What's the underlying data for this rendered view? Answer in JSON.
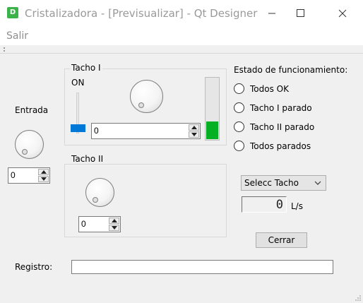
{
  "window": {
    "app_icon_letter": "D",
    "title": "Cristalizadora - [Previsualizar] - Qt Designer"
  },
  "menu": {
    "items": [
      "Salir"
    ]
  },
  "entrada": {
    "label": "Entrada",
    "spin_value": "0"
  },
  "tacho1": {
    "group_title": "Tacho I",
    "on_label": "ON",
    "spin_value": "0",
    "level_percent": 28,
    "level_color": "#06b025",
    "slider_color": "#0078d7"
  },
  "tacho2": {
    "group_title": "Tacho II",
    "spin_value": "0"
  },
  "estado": {
    "title": "Estado de funcionamiento:",
    "options": [
      "Todos OK",
      "Tacho I parado",
      "Tacho II parado",
      "Todos parados"
    ]
  },
  "combo": {
    "value": "Selecc Tacho"
  },
  "flow": {
    "display_value": "0",
    "unit": "L/s"
  },
  "buttons": {
    "close_label": "Cerrar"
  },
  "registro": {
    "label": "Registro:",
    "value": ""
  }
}
